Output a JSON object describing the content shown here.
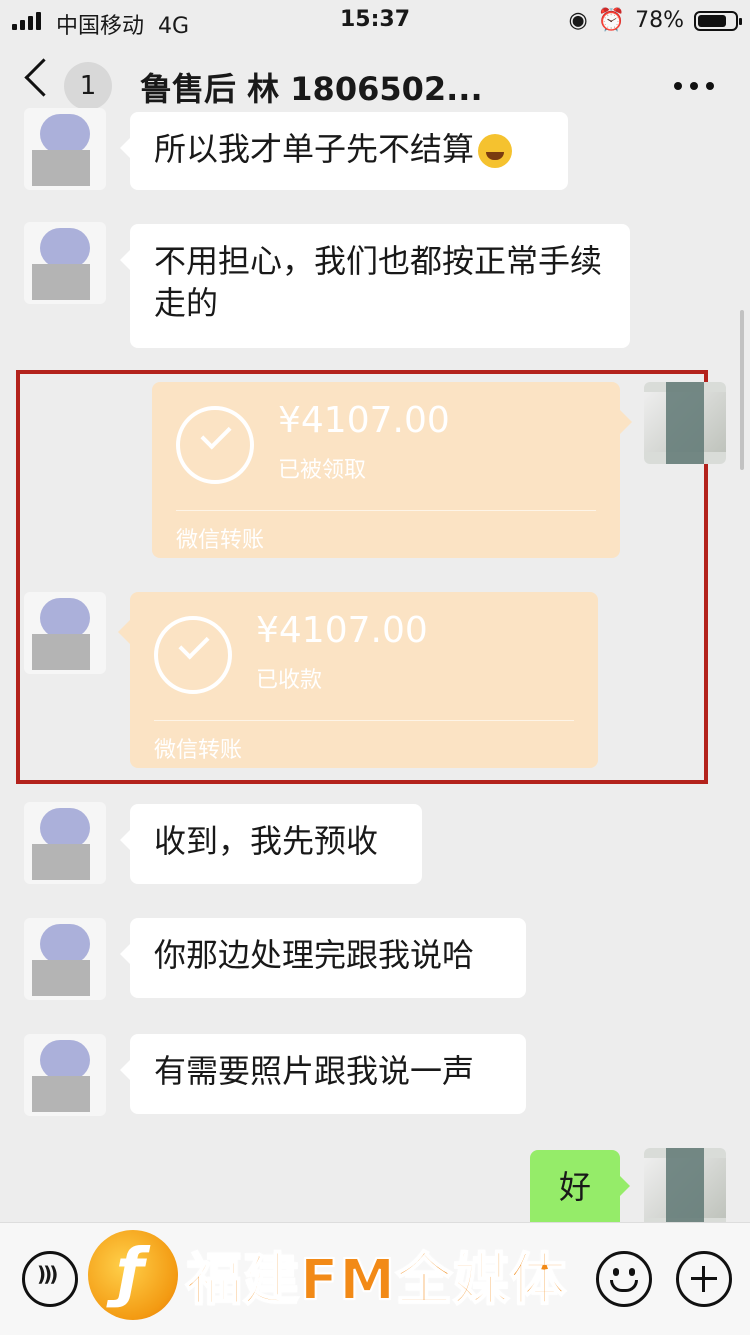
{
  "status_bar": {
    "carrier": "中国移动",
    "network": "4G",
    "time": "15:37",
    "battery": "78%",
    "battery_level": 0.78
  },
  "nav": {
    "back_icon": "chevron-left-icon",
    "unread_count": "1",
    "title": "鲁售后 林 1806502...",
    "more_icon": "more-dots-icon"
  },
  "messages": [
    {
      "side": "left",
      "text": "所以我才单子先不结算",
      "emoji": "laughing-crying-emoji"
    },
    {
      "side": "left",
      "text": "不用担心，我们也都按正常手续走的"
    },
    {
      "side": "right",
      "type": "transfer",
      "amount": "¥4107.00",
      "status": "已被领取",
      "source": "微信转账"
    },
    {
      "side": "left",
      "type": "transfer",
      "amount": "¥4107.00",
      "status": "已收款",
      "source": "微信转账"
    },
    {
      "side": "left",
      "text": "收到，我先预收"
    },
    {
      "side": "left",
      "text": "你那边处理完跟我说哈"
    },
    {
      "side": "left",
      "text": "有需要照片跟我说一声"
    },
    {
      "side": "right",
      "text": "好"
    }
  ],
  "input_bar": {
    "voice_icon": "voice-icon",
    "emoji_icon": "emoji-icon",
    "plus_icon": "plus-icon"
  },
  "watermark": {
    "text": "福建FM全媒体"
  },
  "colors": {
    "background": "#ededed",
    "bubble_left": "#ffffff",
    "bubble_right": "#95ec69",
    "transfer": "#fbe3c4",
    "highlight_border": "#b3221c",
    "watermark": "#f28a17"
  }
}
